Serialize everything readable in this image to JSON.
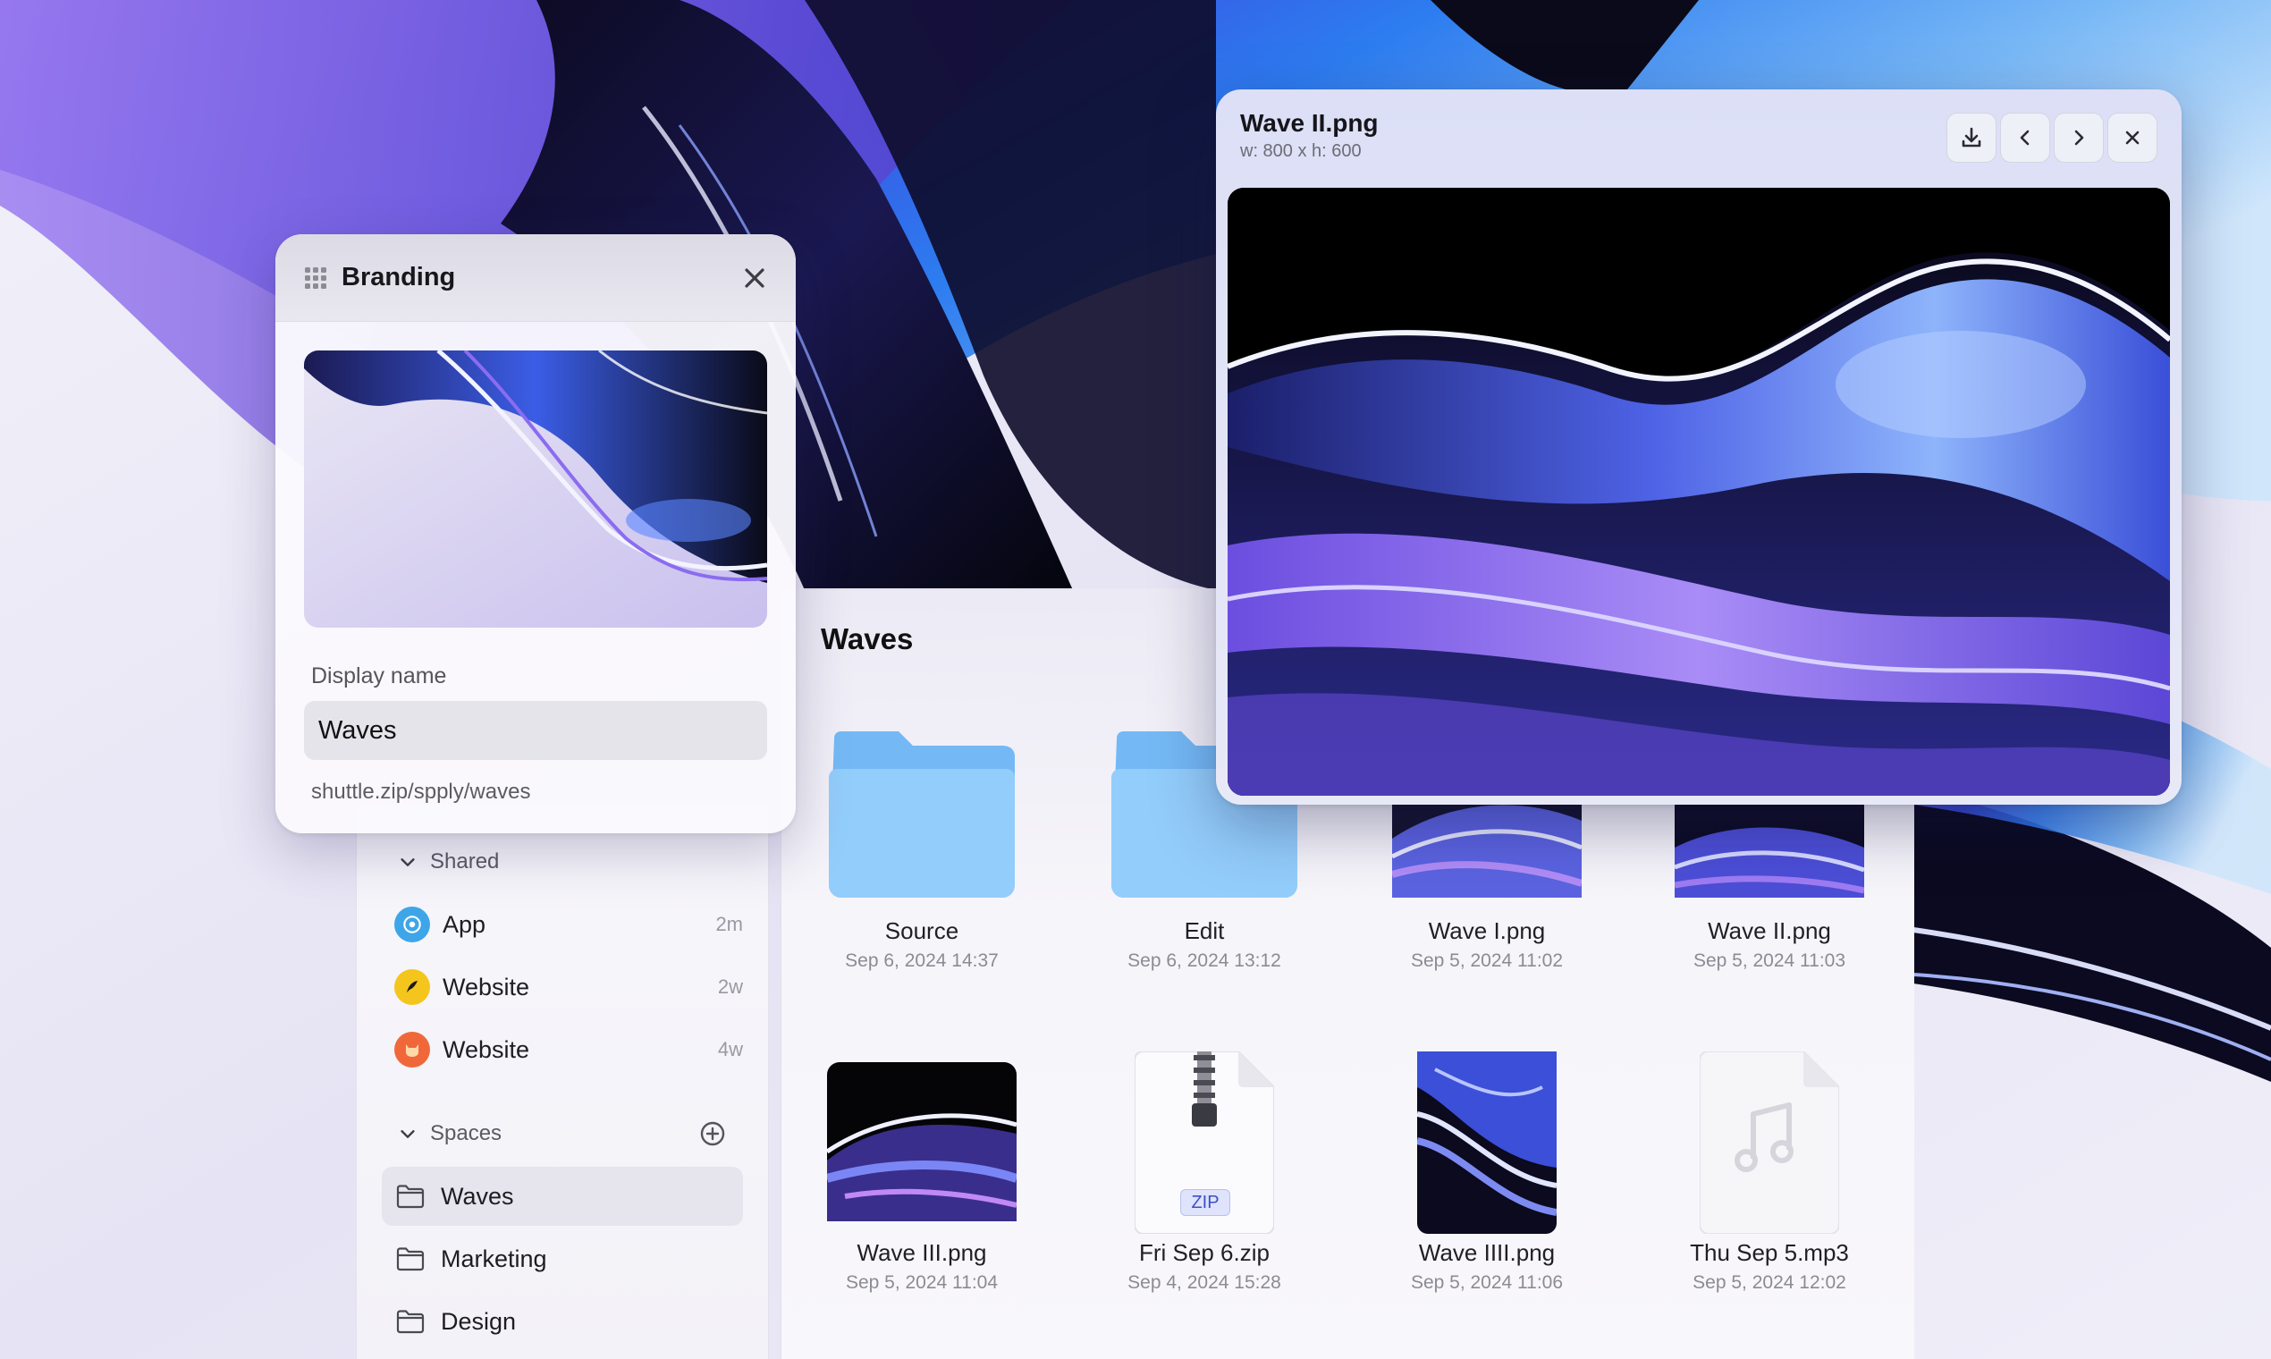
{
  "branding": {
    "title": "Branding",
    "display_name_label": "Display name",
    "display_name_value": "Waves",
    "url_hint": "shuttle.zip/spply/waves"
  },
  "content": {
    "title": "Waves"
  },
  "sidebar": {
    "shared_label": "Shared",
    "shared": [
      {
        "label": "App",
        "ago": "2m",
        "color": "#3ea6e8"
      },
      {
        "label": "Website",
        "ago": "2w",
        "color": "#f4c51c"
      },
      {
        "label": "Website",
        "ago": "4w",
        "color": "#f0683a"
      }
    ],
    "spaces_label": "Spaces",
    "spaces": [
      {
        "label": "Waves",
        "active": true
      },
      {
        "label": "Marketing",
        "active": false
      },
      {
        "label": "Design",
        "active": false
      }
    ]
  },
  "files": [
    {
      "name": "Source",
      "date": "Sep 6, 2024 14:37",
      "kind": "folder"
    },
    {
      "name": "Edit",
      "date": "Sep 6, 2024 13:12",
      "kind": "folder"
    },
    {
      "name": "Wave I.png",
      "date": "Sep 5, 2024 11:02",
      "kind": "image"
    },
    {
      "name": "Wave II.png",
      "date": "Sep 5, 2024 11:03",
      "kind": "image"
    },
    {
      "name": "Wave III.png",
      "date": "Sep 5, 2024 11:04",
      "kind": "image"
    },
    {
      "name": "Fri Sep 6.zip",
      "date": "Sep 4, 2024 15:28",
      "kind": "zip",
      "badge": "ZIP"
    },
    {
      "name": "Wave IIII.png",
      "date": "Sep 5, 2024 11:06",
      "kind": "image"
    },
    {
      "name": "Thu Sep 5.mp3",
      "date": "Sep 5, 2024 12:02",
      "kind": "audio"
    }
  ],
  "preview": {
    "file_name": "Wave II.png",
    "dimensions": "w: 800 x h: 600",
    "buttons": [
      "download-icon",
      "chevron-left-icon",
      "chevron-right-icon",
      "close-icon"
    ]
  },
  "colors": {
    "accent_blue": "#3b6cf0",
    "folder_blue": "#8cc8fb",
    "deep_purple": "#5a3fd8"
  }
}
